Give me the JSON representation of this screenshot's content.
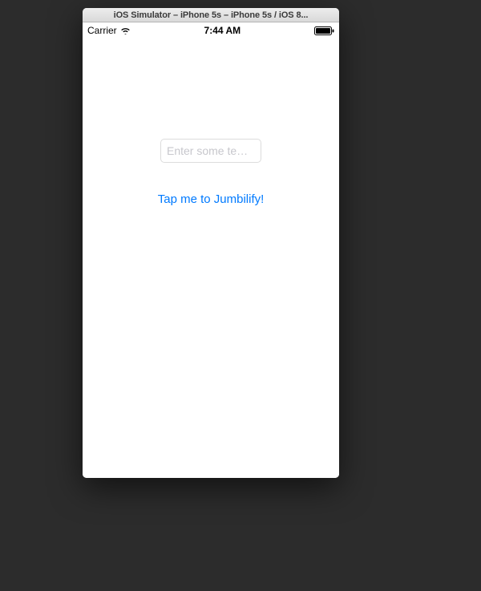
{
  "window": {
    "title": "iOS Simulator – iPhone 5s – iPhone 5s / iOS 8..."
  },
  "status_bar": {
    "carrier": "Carrier",
    "time": "7:44 AM"
  },
  "content": {
    "input_placeholder": "Enter some te…",
    "button_label": "Tap me to Jumbilify!"
  }
}
